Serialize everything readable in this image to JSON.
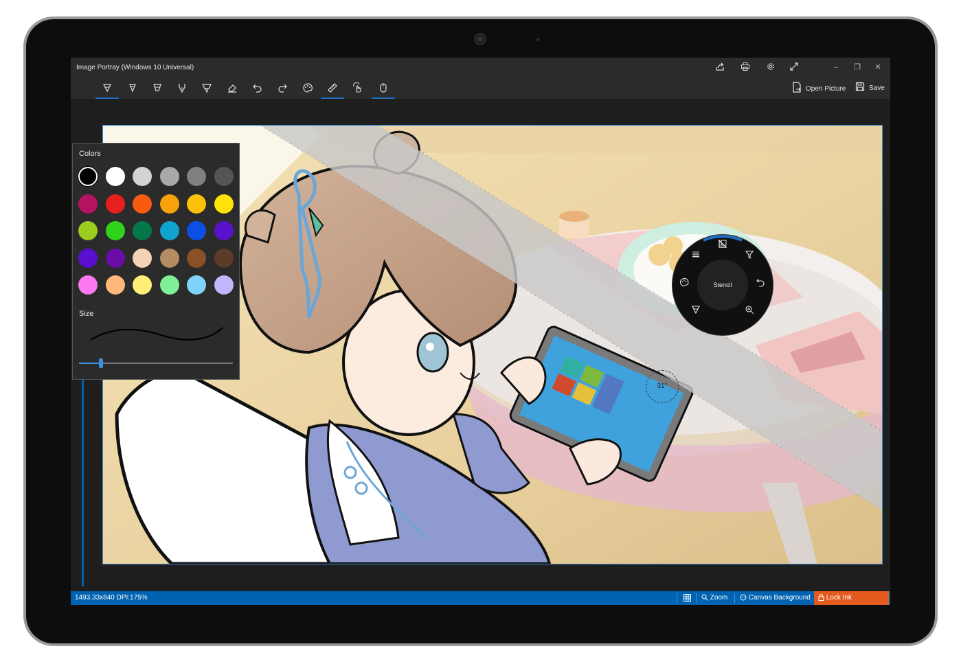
{
  "window": {
    "title": "Image Portray (Windows 10 Universal)",
    "title_icons": [
      "share-icon",
      "print-icon",
      "settings-icon",
      "fullscreen-icon"
    ],
    "controls": [
      "minimize",
      "restore",
      "close"
    ]
  },
  "toolbar": {
    "tools": [
      {
        "name": "ballpoint-pen",
        "icon": "pen-icon",
        "selected": true
      },
      {
        "name": "pencil",
        "icon": "pencil-icon",
        "selected": false
      },
      {
        "name": "highlighter",
        "icon": "highlighter-icon",
        "selected": false
      },
      {
        "name": "calligraphy-pen",
        "icon": "calligraphy-pen-icon",
        "selected": false
      },
      {
        "name": "marker",
        "icon": "marker-icon",
        "selected": false
      },
      {
        "name": "eraser",
        "icon": "eraser-icon",
        "selected": false
      },
      {
        "name": "undo",
        "icon": "undo-icon",
        "selected": false
      },
      {
        "name": "redo",
        "icon": "redo-icon",
        "selected": false
      },
      {
        "name": "color-palette",
        "icon": "palette-icon",
        "selected": false
      },
      {
        "name": "ruler",
        "icon": "ruler-icon",
        "selected": true
      },
      {
        "name": "touch-writing",
        "icon": "touch-icon",
        "selected": false
      },
      {
        "name": "mouse-input",
        "icon": "mouse-icon",
        "selected": true
      }
    ],
    "open_picture_label": "Open Picture",
    "save_label": "Save"
  },
  "palette": {
    "colors_label": "Colors",
    "size_label": "Size",
    "size_value_fraction": 0.14,
    "colors": [
      [
        "#000000",
        "#ffffff",
        "#d3d3d3",
        "#a9a9a9",
        "#808080",
        "#555555"
      ],
      [
        "#b5135f",
        "#e6201c",
        "#f75b0f",
        "#f7a10b",
        "#fcc20a",
        "#ffe20a"
      ],
      [
        "#9acd1e",
        "#2fd31a",
        "#05784b",
        "#10a3cf",
        "#0b4fe6",
        "#5a11cc"
      ],
      [
        "#5a0fd0",
        "#6a0ca6",
        "#f4d2b6",
        "#b58c63",
        "#8a5128",
        "#5e3a2a"
      ],
      [
        "#fb78f0",
        "#ffb87a",
        "#ffee77",
        "#7ff095",
        "#7fd3fa",
        "#c3b6fc"
      ]
    ],
    "selected_color": "#000000"
  },
  "radial_menu": {
    "center_label": "Stencil",
    "items": [
      "ruler-stencil-icon",
      "filter-icon",
      "undo-icon",
      "zoom-icon",
      "pen-icon",
      "palette-icon",
      "line-thickness-icon"
    ]
  },
  "ruler": {
    "angle_label": "31°"
  },
  "status": {
    "dimensions": "1493.33x840 DPI:175%",
    "grid_icon": "grid-icon",
    "zoom_label": "Zoom",
    "canvas_bg_label": "Canvas Background",
    "lock_label": "Lock Ink Movement"
  },
  "colors": {
    "accent": "#0063b1",
    "lock_accent": "#e35a1e"
  }
}
